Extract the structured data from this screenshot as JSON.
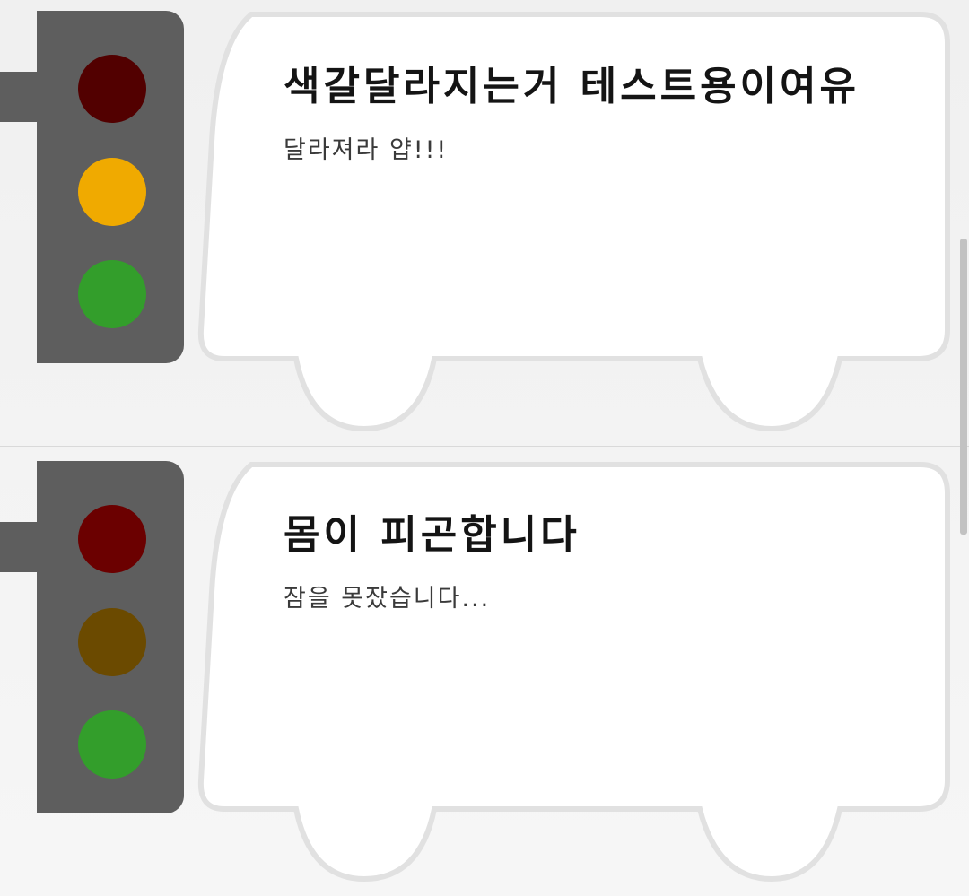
{
  "cards": [
    {
      "title": "색갈달라지는거 테스트용이여유",
      "subtitle": "달라져라 얍!!!",
      "lights": {
        "red": "#520000",
        "yellow": "#f0aa00",
        "green": "#339e2b"
      }
    },
    {
      "title": "몸이 피곤합니다",
      "subtitle": "잠을 못잤습니다...",
      "lights": {
        "red": "#6b0000",
        "yellow": "#6b4a00",
        "green": "#339e2b"
      }
    }
  ],
  "colors": {
    "pole": "#5e5e5e",
    "bus_fill": "#ffffff",
    "bus_outline": "#e1e1e1"
  }
}
